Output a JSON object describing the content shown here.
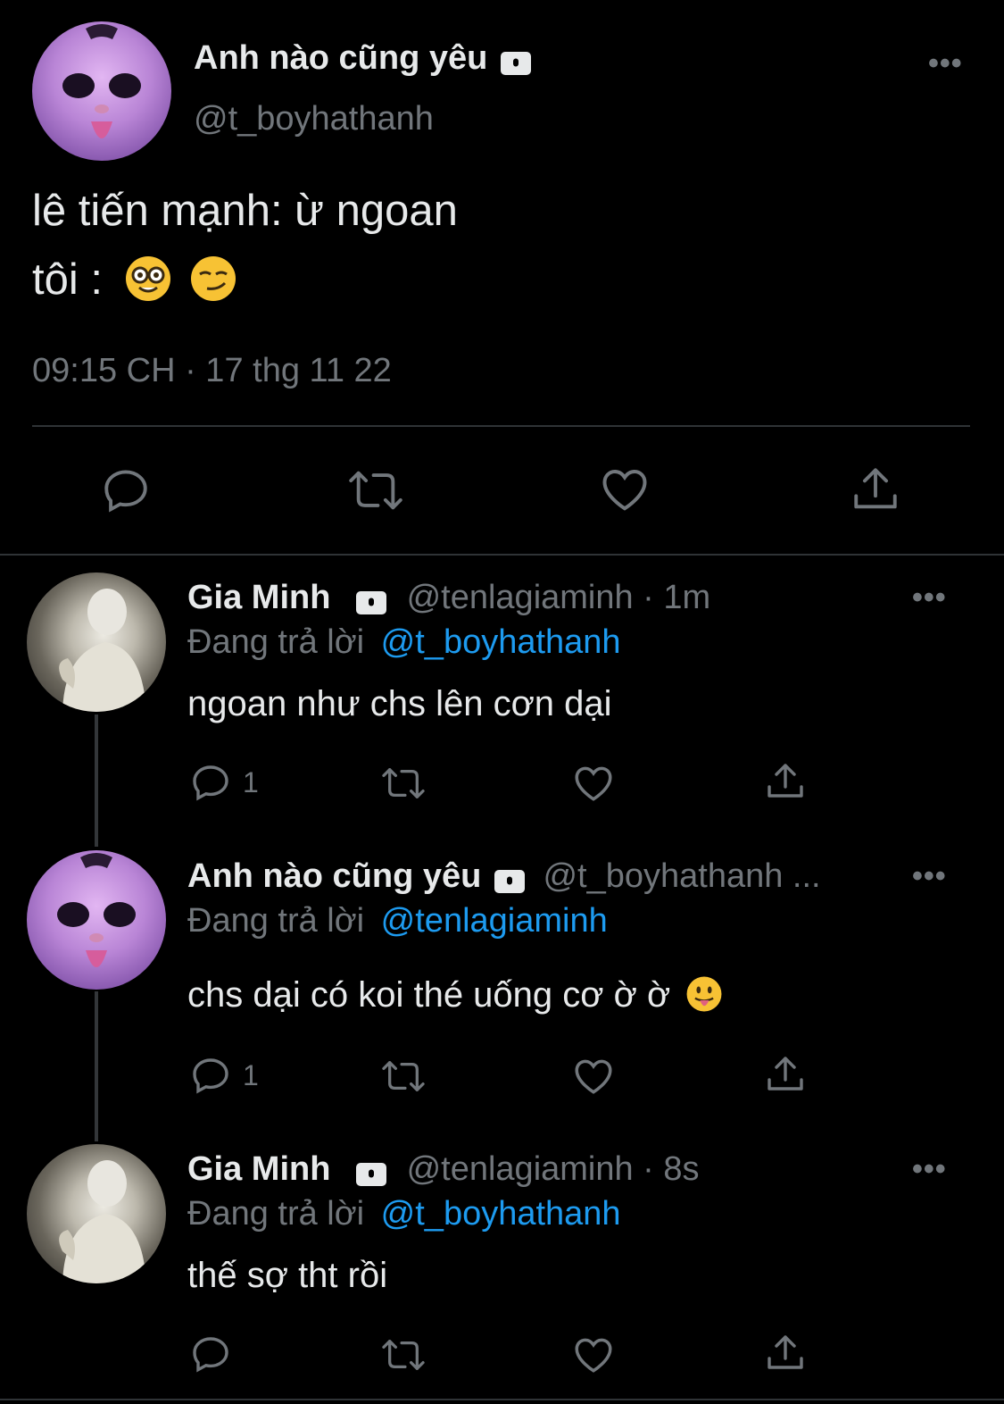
{
  "main_tweet": {
    "display_name": "Anh nào cũng yêu",
    "handle": "@t_boyhathanh",
    "text_line1": "lê tiến mạnh: ừ ngoan",
    "text_line2": "tôi :",
    "emojis": [
      "nerd-face",
      "smirk-face"
    ],
    "timestamp": "09:15 CH · 17 thg 11 22"
  },
  "replies": [
    {
      "display_name": "Gia Minh",
      "handle_time": "@tenlagiaminh · 1m",
      "replying_prefix": "Đang trả lời",
      "replying_to": "@t_boyhathanh",
      "text": "ngoan như chs lên cơn dại",
      "reply_count": "1"
    },
    {
      "display_name": "Anh nào cũng yêu",
      "handle_time": "@t_boyhathanh ...",
      "replying_prefix": "Đang trả lời",
      "replying_to": "@tenlagiaminh",
      "text": "chs dại có koi thé uống cơ ờ ờ",
      "emoji": "tongue-face",
      "reply_count": "1"
    },
    {
      "display_name": "Gia Minh",
      "handle_time": "@tenlagiaminh · 8s",
      "replying_prefix": "Đang trả lời",
      "replying_to": "@t_boyhathanh",
      "text": "thế sợ tht rồi",
      "reply_count": ""
    }
  ],
  "colors": {
    "background": "#000000",
    "text": "#e7e9ea",
    "muted": "#71767b",
    "link": "#1d9bf0",
    "divider": "#2f3336"
  }
}
